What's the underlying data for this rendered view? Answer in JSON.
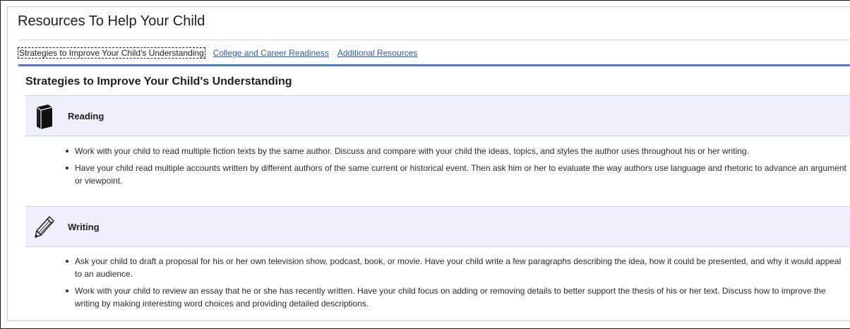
{
  "header": {
    "title": "Resources To Help Your Child"
  },
  "tabs": [
    {
      "label": "Strategies to Improve Your Child's Understanding",
      "active": true
    },
    {
      "label": "College and Career Readiness",
      "active": false
    },
    {
      "label": "Additional Resources",
      "active": false
    }
  ],
  "colors": {
    "accent": "#4a7bd6",
    "link": "#2a5ab3",
    "band_background": "#eef1fb"
  },
  "section": {
    "title": "Strategies to Improve Your Child's Understanding",
    "groups": [
      {
        "label": "Reading",
        "icon": "book-icon",
        "items": [
          "Work with your child to read multiple fiction texts by the same author. Discuss and compare with your child the ideas, topics, and styles the author uses throughout his or her writing.",
          "Have your child read multiple accounts written by different authors of the same current or historical event. Then ask him or her to evaluate the way authors use language and rhetoric to advance an argument or viewpoint."
        ]
      },
      {
        "label": "Writing",
        "icon": "pencil-icon",
        "items": [
          "Ask your child to draft a proposal for his or her own television show, podcast, book, or movie. Have your child write a few paragraphs describing the idea, how it could be presented, and why it would appeal to an audience.",
          "Work with your child to review an essay that he or she has recently written. Have your child focus on adding or removing details to better support the thesis of his or her text. Discuss how to improve the writing by making interesting word choices and providing detailed descriptions."
        ]
      }
    ]
  }
}
